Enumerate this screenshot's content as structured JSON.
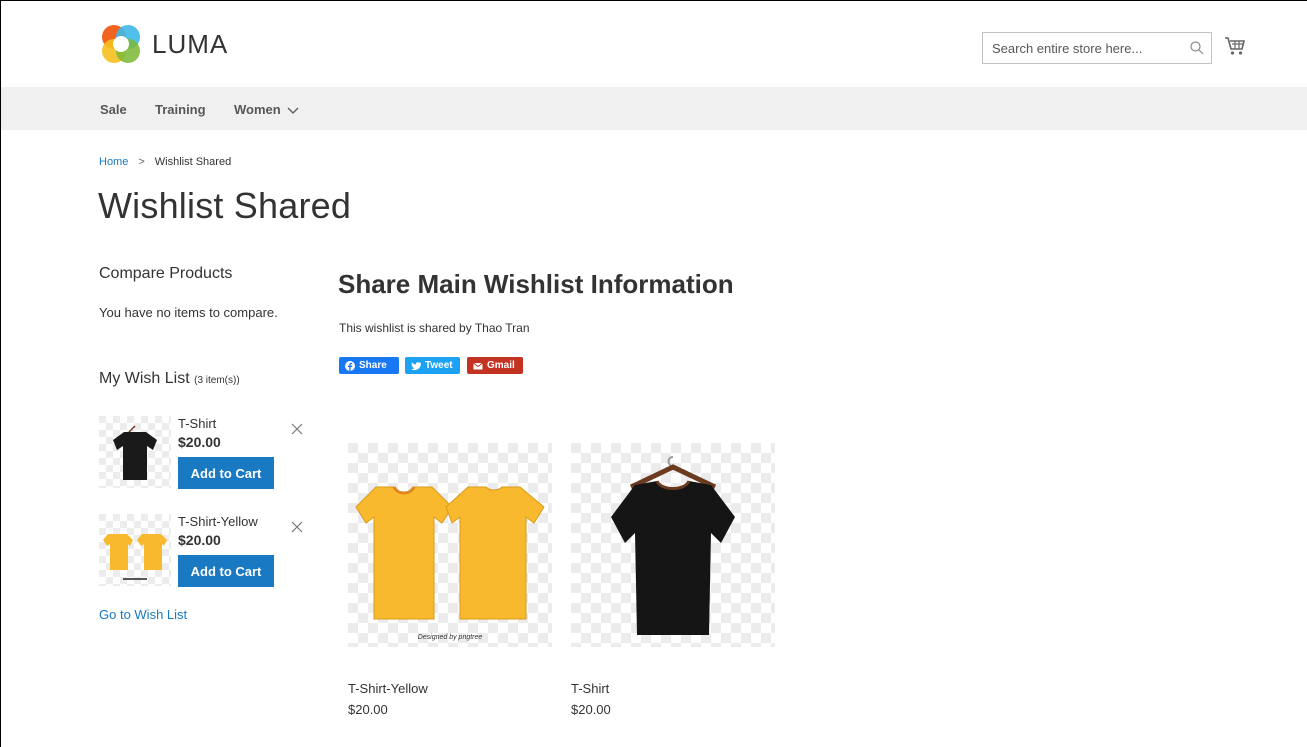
{
  "header": {
    "logo_text": "LUMA",
    "search_placeholder": "Search entire store here...",
    "cart_icon": "cart-icon",
    "search_icon": "search-icon"
  },
  "nav": {
    "items": [
      {
        "label": "Sale"
      },
      {
        "label": "Training"
      },
      {
        "label": "Women",
        "icon": "chevron-down-icon"
      }
    ]
  },
  "breadcrumb": {
    "home": "Home",
    "separator": ">",
    "current": "Wishlist Shared"
  },
  "page_title": "Wishlist Shared",
  "sidebar": {
    "compare": {
      "title": "Compare Products",
      "empty_text": "You have no items to compare."
    },
    "wishlist": {
      "title": "My Wish List",
      "count": "(3 item(s))",
      "items": [
        {
          "name": "T-Shirt",
          "price": "$20.00",
          "button": "Add to Cart",
          "color": "#1a1a1a"
        },
        {
          "name": "T-Shirt-Yellow",
          "price": "$20.00",
          "button": "Add to Cart",
          "color": "#f9b92e"
        }
      ],
      "go_link": "Go to Wish List"
    }
  },
  "main": {
    "title": "Share Main Wishlist Information",
    "shared_by": "This wishlist is shared by Thao Tran",
    "share_buttons": [
      {
        "label": "Share",
        "color": "#1877f2",
        "icon": "facebook-icon"
      },
      {
        "label": "Tweet",
        "color": "#1da1f2",
        "icon": "twitter-icon"
      },
      {
        "label": "Gmail",
        "color": "#c23321",
        "icon": "mail-icon"
      }
    ],
    "products": [
      {
        "name": "T-Shirt-Yellow",
        "price": "$20.00",
        "watermark": "Designed by pngtree"
      },
      {
        "name": "T-Shirt",
        "price": "$20.00"
      }
    ]
  },
  "colors": {
    "accent": "#1979c3",
    "nav_bg": "#f0f0f0"
  }
}
